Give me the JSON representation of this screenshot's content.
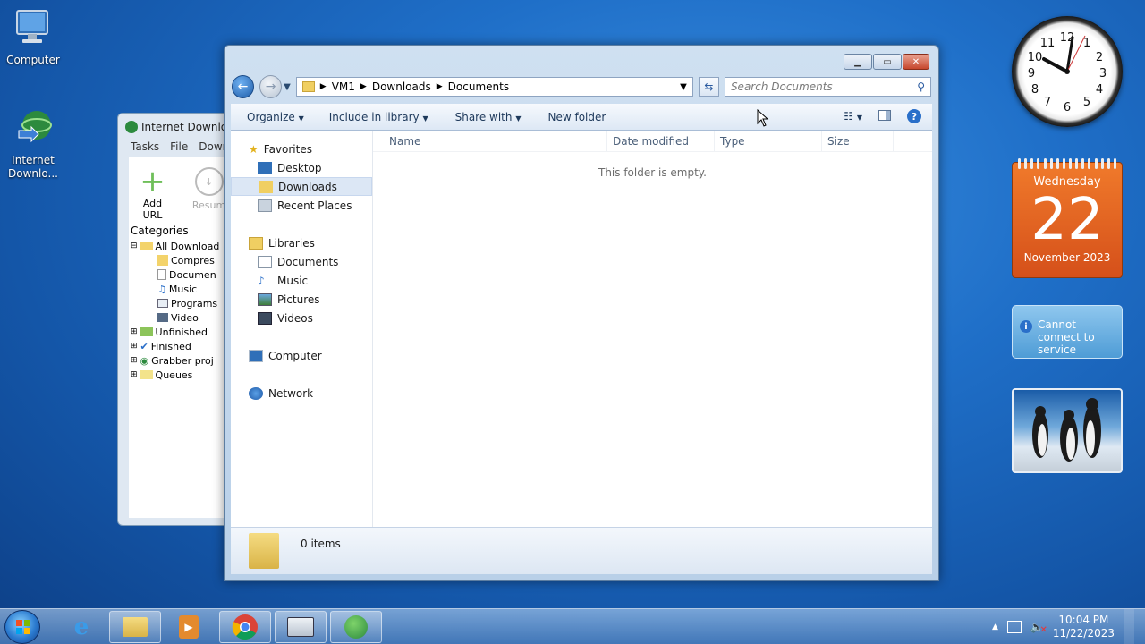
{
  "desktop": {
    "icons": [
      {
        "label": "Computer"
      },
      {
        "label": "Internet Downlo..."
      }
    ]
  },
  "idm": {
    "title": "Internet Downlo",
    "menu": [
      "Tasks",
      "File",
      "Downl"
    ],
    "toolbar": {
      "add_url": "Add URL",
      "resume": "Resum"
    },
    "categories_label": "Categories",
    "tree": [
      {
        "label": "All Download",
        "level": 0
      },
      {
        "label": "Compres",
        "level": 1
      },
      {
        "label": "Documen",
        "level": 1
      },
      {
        "label": "Music",
        "level": 1
      },
      {
        "label": "Programs",
        "level": 1
      },
      {
        "label": "Video",
        "level": 1
      },
      {
        "label": "Unfinished",
        "level": 0
      },
      {
        "label": "Finished",
        "level": 0
      },
      {
        "label": "Grabber proj",
        "level": 0
      },
      {
        "label": "Queues",
        "level": 0
      }
    ]
  },
  "explorer": {
    "breadcrumb": [
      "VM1",
      "Downloads",
      "Documents"
    ],
    "search_placeholder": "Search Documents",
    "commands": {
      "organize": "Organize",
      "include_in_library": "Include in library",
      "share_with": "Share with",
      "new_folder": "New folder"
    },
    "nav": {
      "favorites": "Favorites",
      "desktop": "Desktop",
      "downloads": "Downloads",
      "recent_places": "Recent Places",
      "libraries": "Libraries",
      "documents": "Documents",
      "music": "Music",
      "pictures": "Pictures",
      "videos": "Videos",
      "computer": "Computer",
      "network": "Network"
    },
    "columns": {
      "name": "Name",
      "date_modified": "Date modified",
      "type": "Type",
      "size": "Size"
    },
    "empty_message": "This folder is empty.",
    "details": {
      "item_count": "0 items"
    }
  },
  "gadgets": {
    "calendar": {
      "weekday": "Wednesday",
      "day": "22",
      "month_year": "November 2023"
    },
    "weather": {
      "message": "Cannot connect to service"
    }
  },
  "taskbar": {
    "time": "10:04 PM",
    "date": "11/22/2023"
  }
}
